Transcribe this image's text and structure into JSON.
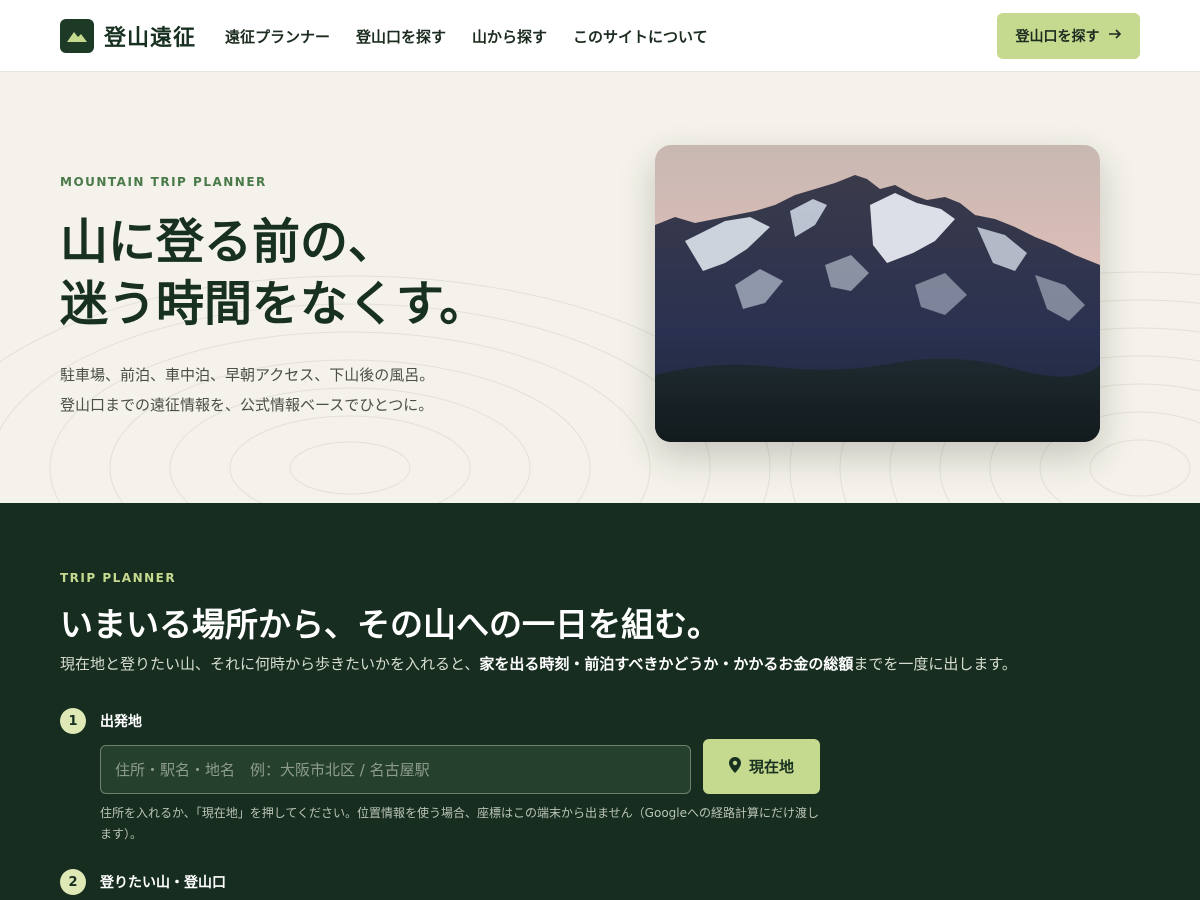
{
  "header": {
    "logo_text": "登山遠征",
    "logo_icon": "mountain-icon",
    "nav": [
      {
        "label": "遠征プランナー"
      },
      {
        "label": "登山口を探す"
      },
      {
        "label": "山から探す"
      },
      {
        "label": "このサイトについて"
      }
    ],
    "cta_label": "登山口を探す",
    "cta_icon": "arrow-right-icon"
  },
  "hero": {
    "eyebrow": "MOUNTAIN TRIP PLANNER",
    "title_line1": "山に登る前の、",
    "title_line2": "迷う時間をなくす。",
    "sub_line1": "駐車場、前泊、車中泊、早朝アクセス、下山後の風呂。",
    "sub_line2": "登山口までの遠征情報を、公式情報ベースでひとつに。",
    "photo_subject": "snow-capped-mountain-photo"
  },
  "planner": {
    "eyebrow": "TRIP PLANNER",
    "title": "いまいる場所から、その山への一日を組む。",
    "desc_before": "現在地と登りたい山、それに何時から歩きたいかを入れると、",
    "desc_strong": "家を出る時刻・前泊すべきかどうか・かかるお金の総額",
    "desc_after": "までを一度に出します。",
    "steps": [
      {
        "number": "1",
        "label": "出発地",
        "placeholder": "住所・駅名・地名　例：大阪市北区 / 名古屋駅",
        "button_label": "現在地",
        "button_icon": "location-pin-icon",
        "hint": "住所を入れるか、「現在地」を押してください。位置情報を使う場合、座標はこの端末から出ません（Googleへの経路計算にだけ渡します）。"
      },
      {
        "number": "2",
        "label": "登りたい山・登山口"
      }
    ]
  },
  "colors": {
    "brand_dark": "#162d1f",
    "accent": "#c5d98f",
    "background": "#f4f2ea"
  }
}
